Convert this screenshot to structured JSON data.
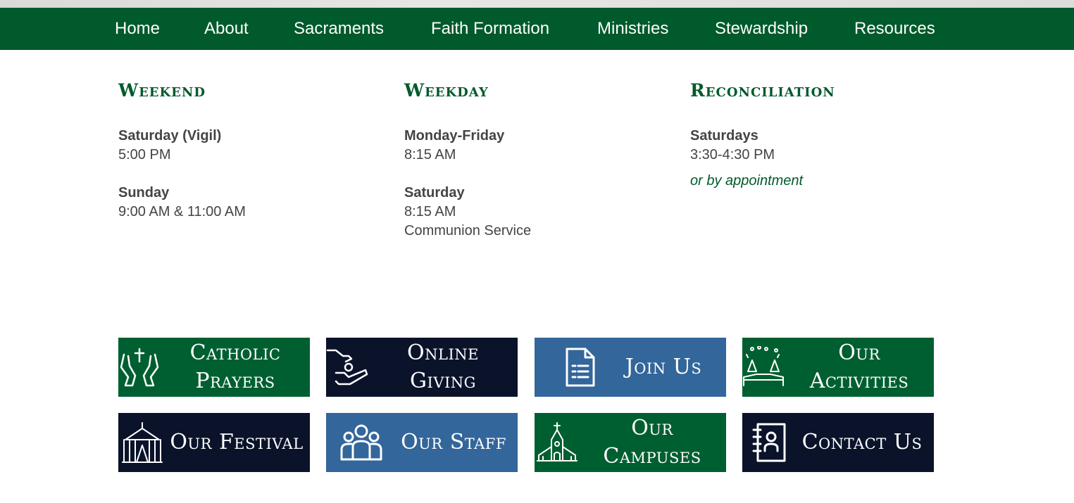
{
  "nav": {
    "items": [
      "Home",
      "About",
      "Sacraments",
      "Faith Formation",
      "Ministries",
      "Stewardship",
      "Resources"
    ]
  },
  "schedule": {
    "weekend": {
      "title": "Weekend",
      "blocks": [
        {
          "day": "Saturday (Vigil)",
          "times": [
            "5:00 PM"
          ]
        },
        {
          "day": "Sunday",
          "times": [
            "9:00 AM & 11:00 AM"
          ]
        }
      ]
    },
    "weekday": {
      "title": "Weekday",
      "blocks": [
        {
          "day": "Monday-Friday",
          "times": [
            "8:15 AM"
          ]
        },
        {
          "day": "Saturday",
          "times": [
            "8:15 AM",
            "Communion Service"
          ]
        }
      ]
    },
    "reconciliation": {
      "title": "Reconciliation",
      "blocks": [
        {
          "day": "Saturdays",
          "times": [
            "3:30-4:30 PM"
          ]
        }
      ],
      "note": "or by appointment"
    }
  },
  "tiles": [
    {
      "label": "Catholic\nPrayers",
      "icon": "praying-hands-icon",
      "color": "#005f31"
    },
    {
      "label": "Online\nGiving",
      "icon": "giving-hand-icon",
      "color": "#0b132b"
    },
    {
      "label": "Join Us",
      "icon": "document-icon",
      "color": "#33669a"
    },
    {
      "label": "Our\nActivities",
      "icon": "festival-activities-icon",
      "color": "#005f31"
    },
    {
      "label": "Our Festival",
      "icon": "tent-icon",
      "color": "#0b132b"
    },
    {
      "label": "Our Staff",
      "icon": "people-icon",
      "color": "#33669a"
    },
    {
      "label": "Our\nCampuses",
      "icon": "church-icon",
      "color": "#005f31"
    },
    {
      "label": "Contact Us",
      "icon": "address-book-icon",
      "color": "#0b132b"
    }
  ]
}
